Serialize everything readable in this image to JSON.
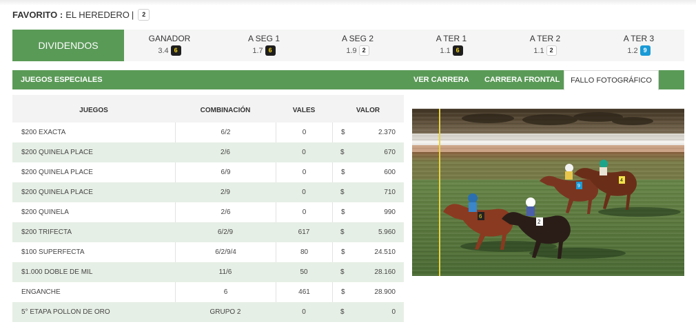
{
  "favorito": {
    "label": "FAVORITO :",
    "name": "EL HEREDERO",
    "separator": "|",
    "number": "2"
  },
  "dividendos": {
    "title": "DIVIDENDOS",
    "items": [
      {
        "label": "GANADOR",
        "value": "3.4",
        "badge": "6",
        "badge_style": "black"
      },
      {
        "label": "A SEG 1",
        "value": "1.7",
        "badge": "6",
        "badge_style": "black"
      },
      {
        "label": "A SEG 2",
        "value": "1.9",
        "badge": "2",
        "badge_style": "white"
      },
      {
        "label": "A TER 1",
        "value": "1.1",
        "badge": "6",
        "badge_style": "black"
      },
      {
        "label": "A TER 2",
        "value": "1.1",
        "badge": "2",
        "badge_style": "white"
      },
      {
        "label": "A TER 3",
        "value": "1.2",
        "badge": "9",
        "badge_style": "blue"
      }
    ]
  },
  "section": {
    "title": "JUEGOS ESPECIALES",
    "tabs": [
      {
        "label": "VER CARRERA",
        "active": false
      },
      {
        "label": "CARRERA FRONTAL",
        "active": false
      },
      {
        "label": "FALLO FOTOGRÁFICO",
        "active": true
      }
    ]
  },
  "table": {
    "headers": [
      "JUEGOS",
      "COMBINACIÓN",
      "VALES",
      "VALOR"
    ],
    "currency": "$",
    "rows": [
      {
        "juego": "$200 EXACTA",
        "combinacion": "6/2",
        "vales": "0",
        "valor": "2.370"
      },
      {
        "juego": "$200 QUINELA PLACE",
        "combinacion": "2/6",
        "vales": "0",
        "valor": "670"
      },
      {
        "juego": "$200 QUINELA PLACE",
        "combinacion": "6/9",
        "vales": "0",
        "valor": "600"
      },
      {
        "juego": "$200 QUINELA PLACE",
        "combinacion": "2/9",
        "vales": "0",
        "valor": "710"
      },
      {
        "juego": "$200 QUINELA",
        "combinacion": "2/6",
        "vales": "0",
        "valor": "990"
      },
      {
        "juego": "$200 TRIFECTA",
        "combinacion": "6/2/9",
        "vales": "617",
        "valor": "5.960"
      },
      {
        "juego": "$100 SUPERFECTA",
        "combinacion": "6/2/9/4",
        "vales": "80",
        "valor": "24.510"
      },
      {
        "juego": "$1.000 DOBLE DE MIL",
        "combinacion": "11/6",
        "vales": "50",
        "valor": "28.160"
      },
      {
        "juego": "ENGANCHE",
        "combinacion": "6",
        "vales": "461",
        "valor": "28.900"
      },
      {
        "juego": "5° ETAPA POLLON DE ORO",
        "combinacion": "GRUPO 2",
        "vales": "0",
        "valor": "0"
      }
    ]
  },
  "photo_finish": {
    "horse_numbers": [
      "6",
      "2",
      "9",
      "4"
    ]
  },
  "colors": {
    "green": "#5a9a57",
    "row_alt": "#e6efe5",
    "badge_black": "#1e1e1e",
    "badge_blue": "#1a9ad6"
  }
}
